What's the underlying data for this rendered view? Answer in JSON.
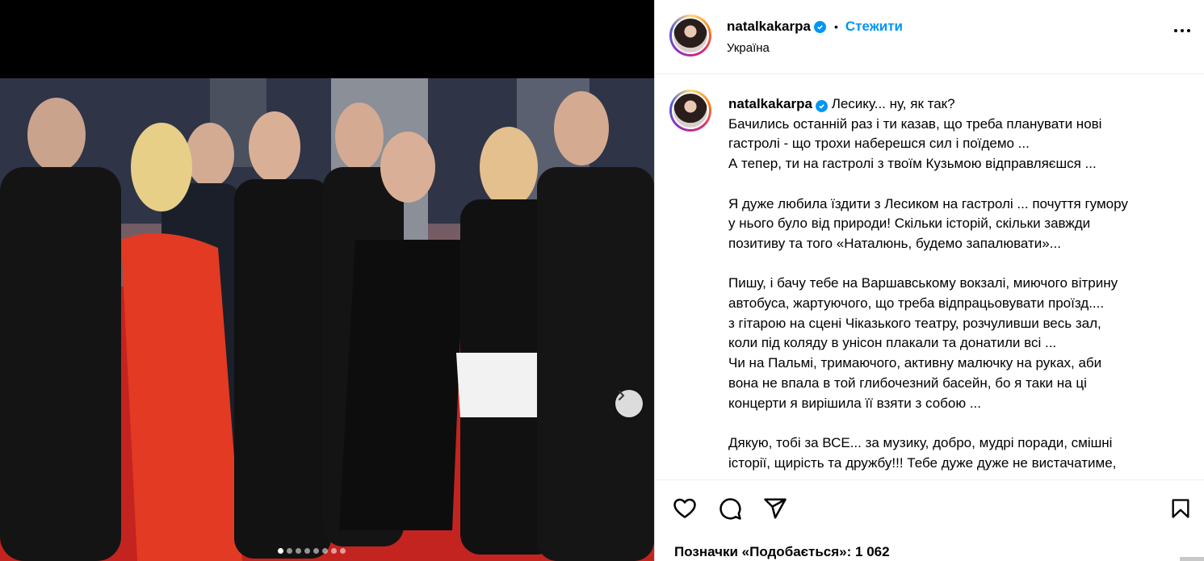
{
  "post": {
    "username": "natalkakarpa",
    "location": "Україна",
    "follow_label": "Стежити",
    "bullet": "•",
    "caption_first_line": "Лесику... ну, як так?",
    "caption_body": "Бачились останній раз і ти казав, що треба планувати нові\nгастролі - що трохи наберешся сил і поїдемо ...\nА тепер, ти на гастролі з твоїм Кузьмою відправляєшся ...\n\nЯ дуже любила їздити з Лесиком на гастролі ... почуття гумору\nу нього було від природи! Скільки історій, скільки завжди\nпозитиву та того «Наталюнь, будемо запалювати»...\n\nПишу, і бачу тебе на Варшавському вокзалі, миючого вітрину\nавтобуса, жартуючого, що треба відпрацьовувати проїзд....\nз гітарою на сцені Чіказького театру, розчуливши весь зал,\nколи під коляду в унісон плакали та донатили всі ...\nЧи на Пальмі, тримаючого, активну малючку на руках, аби\nвона не впала в той глибочезний басейн, бо я таки на ці\nконцерти я вирішила її взяти з собою ...\n\nДякую, тобі за ВСЕ... за музику, добро, мудрі поради, смішні\nісторії, щирість та дружбу!!! Тебе дуже дуже не вистачатиме,",
    "likes_text": "Позначки «Подобається»: 1 062"
  },
  "carousel": {
    "total_slides": 8,
    "active_index": 0
  },
  "icons": [
    "verified-badge-icon",
    "more-options-icon",
    "heart-icon",
    "comment-icon",
    "share-icon",
    "bookmark-icon",
    "chevron-right-icon"
  ],
  "colors": {
    "link_blue": "#0095f6",
    "verified_blue": "#0095f6",
    "border": "#dbdbdb"
  }
}
